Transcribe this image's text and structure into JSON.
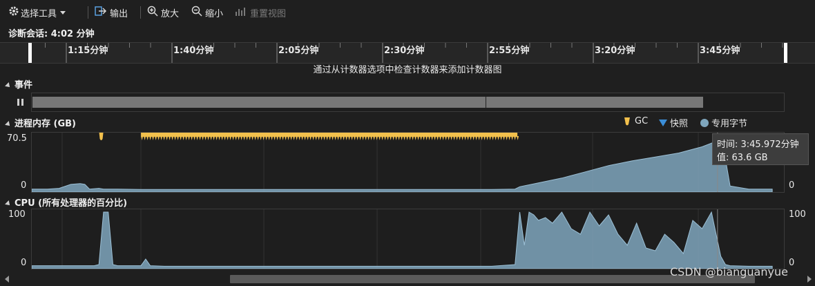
{
  "toolbar": {
    "select_tool": "选择工具",
    "export": "输出",
    "zoom_in": "放大",
    "zoom_out": "缩小",
    "reset_view": "重置视图"
  },
  "session": {
    "label": "诊断会话: 4:02 分钟"
  },
  "ruler": {
    "ticks": [
      "1:15分钟",
      "1:40分钟",
      "2:05分钟",
      "2:30分钟",
      "2:55分钟",
      "3:20分钟",
      "3:45分钟"
    ]
  },
  "hint": "通过从计数器选项中检查计数器来添加计数器图",
  "events": {
    "title": "事件"
  },
  "memory": {
    "title": "进程内存 (GB)",
    "legend": {
      "gc": "GC",
      "snapshot": "快照",
      "private_bytes": "专用字节"
    },
    "y_max_label": "70.5",
    "y_min_label": "0",
    "y_min_label_right": "0"
  },
  "tooltip": {
    "time": "时间: 3:45.972分钟",
    "value": "值: 63.6 GB"
  },
  "cpu": {
    "title": "CPU (所有处理器的百分比)",
    "y_max_label": "100",
    "y_min_label": "0",
    "y_max_label_right": "100",
    "y_min_label_right": "0"
  },
  "watermark": "CSDN @bianguanyue",
  "colors": {
    "gc": "#f2c04c",
    "snapshot": "#3b8ed8",
    "series": "#7fa6bd",
    "event_bar": "#777777"
  },
  "chart_data": [
    {
      "type": "area",
      "name": "进程内存 (GB)",
      "xlabel": "分钟",
      "ylabel": "GB",
      "xlim": [
        0.833,
        4.05
      ],
      "ylim": [
        0,
        70.5
      ],
      "x": [
        0.833,
        0.9,
        0.95,
        1.0,
        1.04,
        1.06,
        1.08,
        1.12,
        1.14,
        1.2,
        1.3,
        1.5,
        1.8,
        2.0,
        2.3,
        2.6,
        2.8,
        2.9,
        2.92,
        3.0,
        3.1,
        3.2,
        3.3,
        3.4,
        3.5,
        3.6,
        3.7,
        3.766,
        3.78,
        3.8,
        3.82,
        3.9,
        3.96,
        4.0
      ],
      "series": [
        {
          "name": "专用字节",
          "values": [
            2,
            2,
            3,
            8,
            9,
            8,
            2,
            3,
            2,
            2,
            1.5,
            1.5,
            1.5,
            1.5,
            1.5,
            1.5,
            1.5,
            2,
            5,
            10,
            16,
            24,
            32,
            38,
            43,
            48,
            56,
            63.6,
            66,
            40,
            6,
            2,
            2,
            2
          ]
        }
      ],
      "gc_range": [
        1.3,
        2.91
      ],
      "gc_single": 1.13,
      "grid": true
    },
    {
      "type": "area",
      "name": "CPU (所有处理器的百分比)",
      "xlim": [
        0.833,
        4.05
      ],
      "ylim": [
        0,
        100
      ],
      "x": [
        0.833,
        0.95,
        1.1,
        1.12,
        1.14,
        1.16,
        1.18,
        1.2,
        1.25,
        1.3,
        1.32,
        1.34,
        1.4,
        1.6,
        2.0,
        2.4,
        2.8,
        2.9,
        2.92,
        2.94,
        2.96,
        2.98,
        3.0,
        3.03,
        3.06,
        3.1,
        3.14,
        3.18,
        3.22,
        3.26,
        3.3,
        3.34,
        3.38,
        3.42,
        3.46,
        3.5,
        3.54,
        3.58,
        3.62,
        3.66,
        3.7,
        3.74,
        3.78,
        3.8,
        3.82,
        3.9,
        4.0
      ],
      "series": [
        {
          "name": "CPU",
          "values": [
            3,
            3,
            3,
            5,
            100,
            100,
            5,
            3,
            3,
            3,
            15,
            3,
            2,
            2,
            2,
            2,
            2,
            5,
            100,
            40,
            100,
            95,
            85,
            90,
            80,
            100,
            70,
            60,
            100,
            75,
            95,
            60,
            40,
            80,
            35,
            30,
            60,
            45,
            25,
            85,
            70,
            100,
            20,
            5,
            3,
            2,
            2
          ]
        }
      ],
      "grid": true
    }
  ]
}
